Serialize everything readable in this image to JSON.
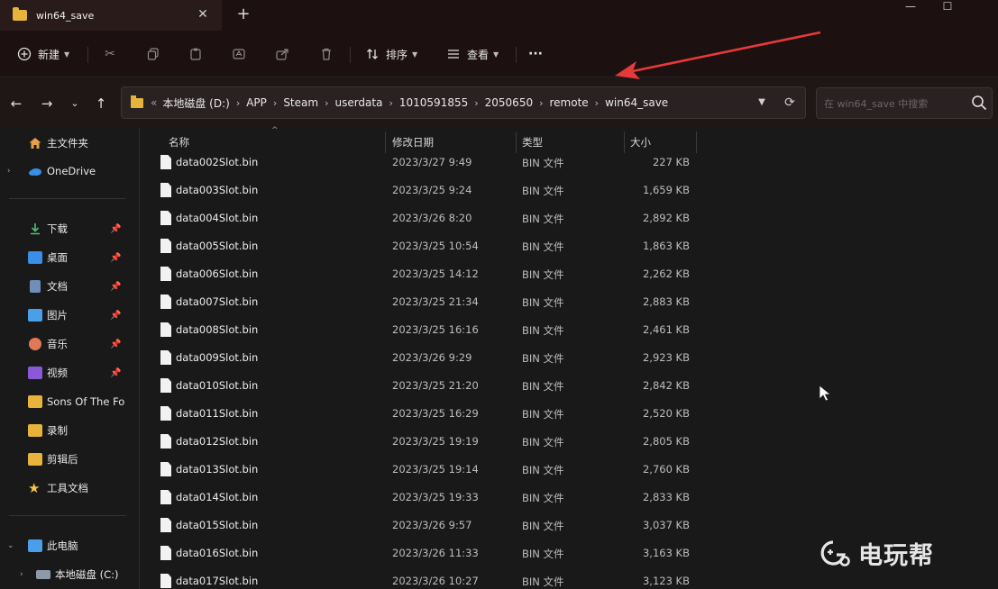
{
  "tab": {
    "title": "win64_save",
    "close": "✕",
    "new": "+"
  },
  "window": {
    "minimize": "—",
    "maximize": "☐"
  },
  "toolbar": {
    "new_label": "新建",
    "sort_label": "排序",
    "view_label": "查看",
    "more": "···"
  },
  "address": {
    "overflow": "«",
    "crumbs": [
      "本地磁盘 (D:)",
      "APP",
      "Steam",
      "userdata",
      "1010591855",
      "2050650",
      "remote",
      "win64_save"
    ]
  },
  "search": {
    "placeholder": "在 win64_save 中搜索"
  },
  "sidebar": {
    "items": [
      {
        "label": "主文件夹"
      },
      {
        "label": "OneDrive"
      },
      {
        "label": "下载"
      },
      {
        "label": "桌面"
      },
      {
        "label": "文档"
      },
      {
        "label": "图片"
      },
      {
        "label": "音乐"
      },
      {
        "label": "视频"
      },
      {
        "label": "Sons Of The Forest"
      },
      {
        "label": "录制"
      },
      {
        "label": "剪辑后"
      },
      {
        "label": "工具文档"
      },
      {
        "label": "此电脑"
      },
      {
        "label": "本地磁盘 (C:)"
      }
    ]
  },
  "columns": {
    "name": "名称",
    "date": "修改日期",
    "type": "类型",
    "size": "大小"
  },
  "files": [
    {
      "name": "data002Slot.bin",
      "date": "2023/3/27 9:49",
      "type": "BIN 文件",
      "size": "227 KB"
    },
    {
      "name": "data003Slot.bin",
      "date": "2023/3/25 9:24",
      "type": "BIN 文件",
      "size": "1,659 KB"
    },
    {
      "name": "data004Slot.bin",
      "date": "2023/3/26 8:20",
      "type": "BIN 文件",
      "size": "2,892 KB"
    },
    {
      "name": "data005Slot.bin",
      "date": "2023/3/25 10:54",
      "type": "BIN 文件",
      "size": "1,863 KB"
    },
    {
      "name": "data006Slot.bin",
      "date": "2023/3/25 14:12",
      "type": "BIN 文件",
      "size": "2,262 KB"
    },
    {
      "name": "data007Slot.bin",
      "date": "2023/3/25 21:34",
      "type": "BIN 文件",
      "size": "2,883 KB"
    },
    {
      "name": "data008Slot.bin",
      "date": "2023/3/25 16:16",
      "type": "BIN 文件",
      "size": "2,461 KB"
    },
    {
      "name": "data009Slot.bin",
      "date": "2023/3/26 9:29",
      "type": "BIN 文件",
      "size": "2,923 KB"
    },
    {
      "name": "data010Slot.bin",
      "date": "2023/3/25 21:20",
      "type": "BIN 文件",
      "size": "2,842 KB"
    },
    {
      "name": "data011Slot.bin",
      "date": "2023/3/25 16:29",
      "type": "BIN 文件",
      "size": "2,520 KB"
    },
    {
      "name": "data012Slot.bin",
      "date": "2023/3/25 19:19",
      "type": "BIN 文件",
      "size": "2,805 KB"
    },
    {
      "name": "data013Slot.bin",
      "date": "2023/3/25 19:14",
      "type": "BIN 文件",
      "size": "2,760 KB"
    },
    {
      "name": "data014Slot.bin",
      "date": "2023/3/25 19:33",
      "type": "BIN 文件",
      "size": "2,833 KB"
    },
    {
      "name": "data015Slot.bin",
      "date": "2023/3/26 9:57",
      "type": "BIN 文件",
      "size": "3,037 KB"
    },
    {
      "name": "data016Slot.bin",
      "date": "2023/3/26 11:33",
      "type": "BIN 文件",
      "size": "3,163 KB"
    },
    {
      "name": "data017Slot.bin",
      "date": "2023/3/26 10:27",
      "type": "BIN 文件",
      "size": "3,123 KB"
    }
  ],
  "watermark": {
    "text": "电玩帮"
  },
  "colors": {
    "accent_arrow": "#e5393a",
    "folder": "#e8b33a",
    "background": "#191919"
  }
}
